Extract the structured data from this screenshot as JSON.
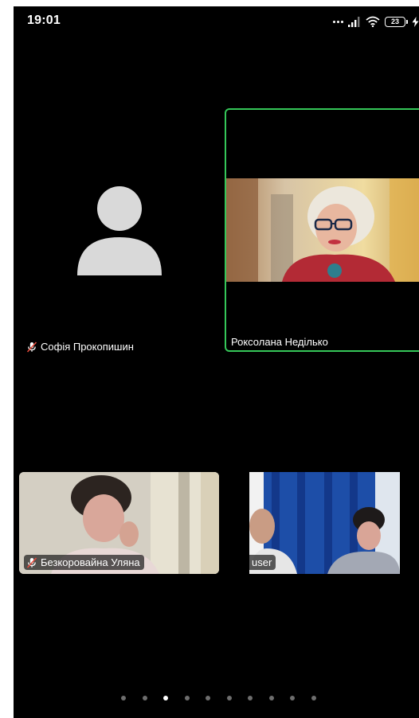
{
  "status_bar": {
    "time": "19:01",
    "battery_level": "23",
    "icons": [
      "more-dots-icon",
      "signal-icon",
      "wifi-icon",
      "battery-icon",
      "charging-bolt-icon"
    ]
  },
  "participants": [
    {
      "name": "Софія Прокопишин",
      "muted": true,
      "video_on": false,
      "active_speaker": false
    },
    {
      "name": "Роксолана Неділько",
      "muted": false,
      "video_on": true,
      "active_speaker": true
    },
    {
      "name": "Безкоровайна Уляна",
      "muted": true,
      "video_on": true,
      "active_speaker": false
    },
    {
      "name": "user",
      "muted": true,
      "video_on": true,
      "active_speaker": false
    }
  ],
  "pagination": {
    "total_pages": 10,
    "current_page": 3
  },
  "colors": {
    "background": "#000000",
    "active_speaker_border": "#35c759",
    "mic_off": "#e54b3c",
    "dot_inactive": "#6e6e6e",
    "dot_active": "#ffffff"
  }
}
